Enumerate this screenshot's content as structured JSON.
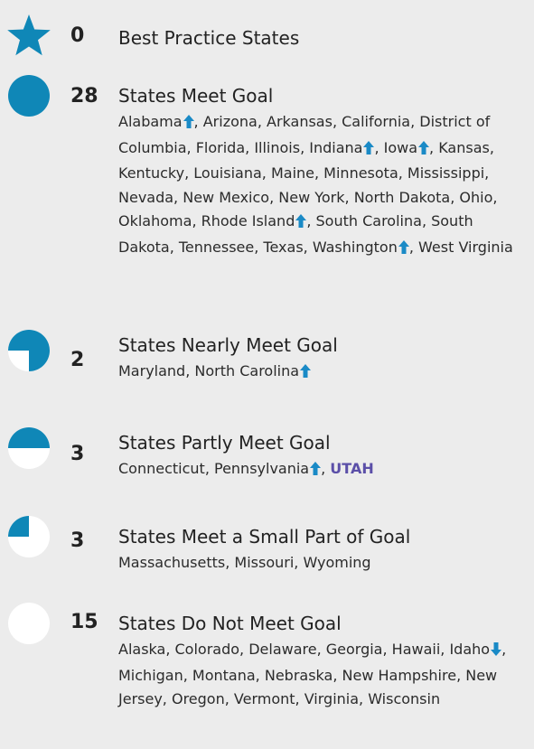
{
  "colors": {
    "fill": "#0f87b7",
    "empty": "#ffffff",
    "up_arrow": "#1a8ac6",
    "down_arrow": "#1a8ac6",
    "utah": "#5b4fa8"
  },
  "groups": [
    {
      "icon": "star-icon",
      "count": "0",
      "title": "Best Practice States",
      "states": []
    },
    {
      "icon": "full-circle-icon",
      "fill_fraction": 1.0,
      "count": "28",
      "title": "States Meet Goal",
      "states": [
        {
          "name": "Alabama",
          "trend": "up"
        },
        {
          "name": "Arizona"
        },
        {
          "name": "Arkansas"
        },
        {
          "name": "California"
        },
        {
          "name": "District of Columbia"
        },
        {
          "name": "Florida"
        },
        {
          "name": "Illinois"
        },
        {
          "name": "Indiana",
          "trend": "up"
        },
        {
          "name": "Iowa",
          "trend": "up"
        },
        {
          "name": "Kansas"
        },
        {
          "name": "Kentucky"
        },
        {
          "name": "Louisiana"
        },
        {
          "name": "Maine"
        },
        {
          "name": "Minnesota"
        },
        {
          "name": "Mississippi"
        },
        {
          "name": "Nevada"
        },
        {
          "name": "New Mexico"
        },
        {
          "name": "New York"
        },
        {
          "name": "North Dakota"
        },
        {
          "name": "Ohio"
        },
        {
          "name": "Oklahoma"
        },
        {
          "name": "Rhode Island",
          "trend": "up"
        },
        {
          "name": "South Carolina"
        },
        {
          "name": "South Dakota"
        },
        {
          "name": "Tennessee"
        },
        {
          "name": "Texas"
        },
        {
          "name": "Washington",
          "trend": "up"
        },
        {
          "name": "West Virginia"
        }
      ]
    },
    {
      "icon": "three-quarter-circle-icon",
      "fill_fraction": 0.75,
      "count": "2",
      "title": "States Nearly Meet Goal",
      "states": [
        {
          "name": "Maryland"
        },
        {
          "name": "North Carolina",
          "trend": "up"
        }
      ]
    },
    {
      "icon": "half-circle-icon",
      "fill_fraction": 0.5,
      "count": "3",
      "title": "States Partly Meet Goal",
      "states": [
        {
          "name": "Connecticut"
        },
        {
          "name": "Pennsylvania",
          "trend": "up"
        },
        {
          "name": "UTAH",
          "highlight": true
        }
      ]
    },
    {
      "icon": "quarter-circle-icon",
      "fill_fraction": 0.25,
      "count": "3",
      "title": "States Meet a Small Part of Goal",
      "states": [
        {
          "name": "Massachusetts"
        },
        {
          "name": "Missouri"
        },
        {
          "name": "Wyoming"
        }
      ]
    },
    {
      "icon": "empty-circle-icon",
      "fill_fraction": 0.0,
      "count": "15",
      "title": "States Do Not Meet Goal",
      "states": [
        {
          "name": "Alaska"
        },
        {
          "name": "Colorado"
        },
        {
          "name": "Delaware"
        },
        {
          "name": "Georgia"
        },
        {
          "name": "Hawaii"
        },
        {
          "name": "Idaho",
          "trend": "down"
        },
        {
          "name": "Michigan"
        },
        {
          "name": "Montana"
        },
        {
          "name": "Nebraska"
        },
        {
          "name": "New Hampshire"
        },
        {
          "name": "New Jersey"
        },
        {
          "name": "Oregon"
        },
        {
          "name": "Vermont"
        },
        {
          "name": "Virginia"
        },
        {
          "name": "Wisconsin"
        }
      ]
    }
  ]
}
